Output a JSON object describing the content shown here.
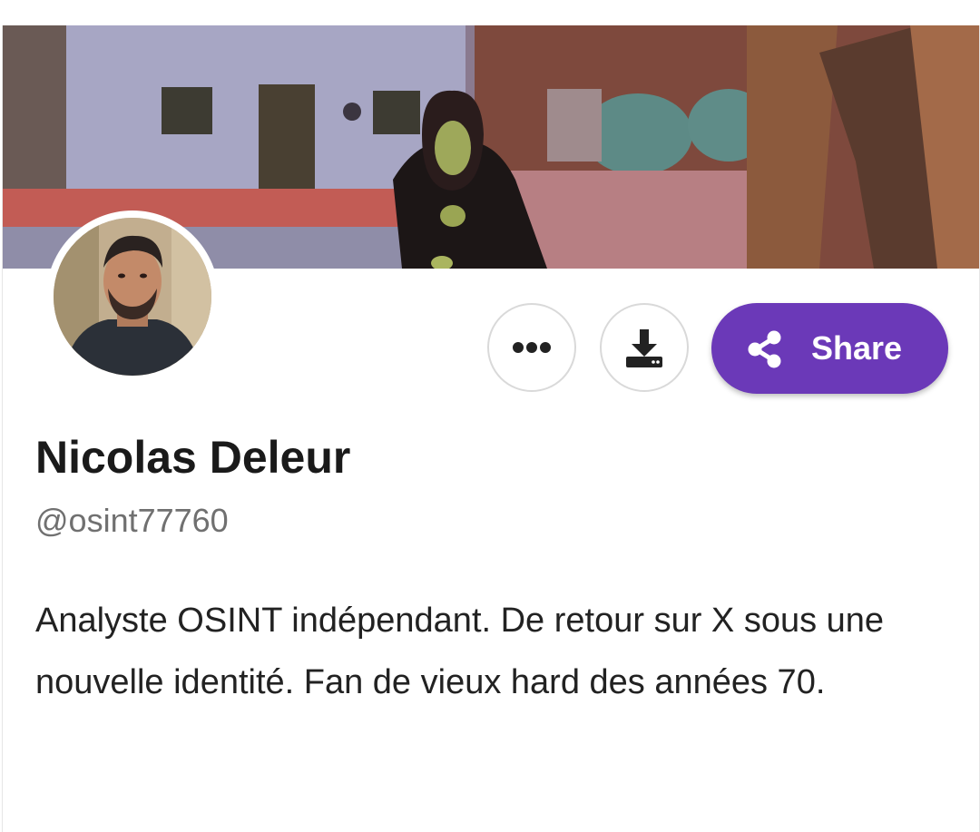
{
  "profile": {
    "display_name": "Nicolas Deleur",
    "handle": "@osint77760",
    "bio": "Analyste OSINT indépendant. De retour sur X sous une nouvelle identité. Fan de vieux hard des années 70."
  },
  "actions": {
    "more_icon": "more-horizontal-icon",
    "download_icon": "download-icon",
    "share_icon": "share-icon",
    "share_label": "Share"
  },
  "colors": {
    "accent": "#6b39b8",
    "name_text": "#1a1a1a",
    "handle_text": "#707070",
    "bio_text": "#222222"
  }
}
